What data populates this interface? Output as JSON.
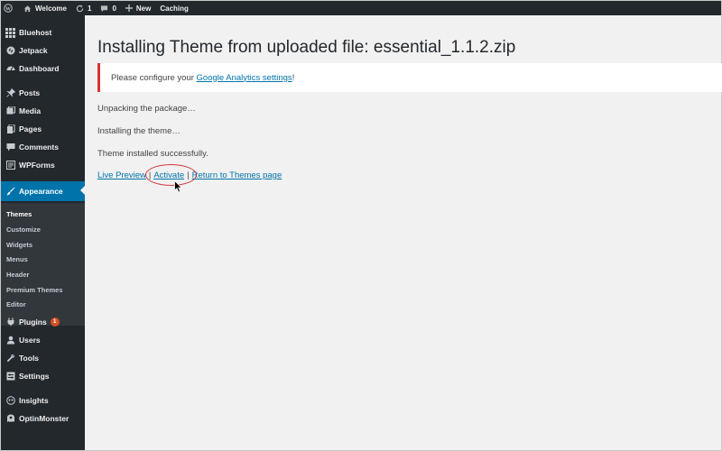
{
  "adminbar": {
    "site": "Welcome",
    "updates": "1",
    "comments": "0",
    "new_label": "New",
    "caching_label": "Caching"
  },
  "sidebar": {
    "items": [
      {
        "label": "Bluehost",
        "icon": "grid-icon"
      },
      {
        "label": "Jetpack",
        "icon": "jetpack-icon"
      },
      {
        "label": "Dashboard",
        "icon": "dashboard-icon"
      },
      {
        "label": "Posts",
        "icon": "pin-icon"
      },
      {
        "label": "Media",
        "icon": "media-icon"
      },
      {
        "label": "Pages",
        "icon": "pages-icon"
      },
      {
        "label": "Comments",
        "icon": "comment-icon"
      },
      {
        "label": "WPForms",
        "icon": "form-icon"
      },
      {
        "label": "Appearance",
        "icon": "brush-icon"
      },
      {
        "label": "Plugins",
        "icon": "plug-icon",
        "badge": "1"
      },
      {
        "label": "Users",
        "icon": "user-icon"
      },
      {
        "label": "Tools",
        "icon": "wrench-icon"
      },
      {
        "label": "Settings",
        "icon": "settings-icon"
      },
      {
        "label": "Insights",
        "icon": "insights-icon"
      },
      {
        "label": "OptinMonster",
        "icon": "monster-icon"
      }
    ],
    "submenu": [
      "Themes",
      "Customize",
      "Widgets",
      "Menus",
      "Header",
      "Premium Themes",
      "Editor"
    ],
    "active_item": "Appearance",
    "current_subitem": "Themes"
  },
  "main": {
    "title": "Installing Theme from uploaded file: essential_1.1.2.zip",
    "notice": {
      "prefix": "Please configure your ",
      "link": "Google Analytics settings",
      "suffix": "!"
    },
    "log": [
      "Unpacking the package…",
      "Installing the theme…",
      "Theme installed successfully."
    ],
    "actions": {
      "live_preview": "Live Preview",
      "activate": "Activate",
      "return": "Return to Themes page",
      "separator": "|"
    }
  },
  "colors": {
    "adminbar_bg": "#23282d",
    "sidebar_bg": "#23282d",
    "submenu_bg": "#32373c",
    "active_bg": "#0073aa",
    "link": "#0073aa",
    "notice_border": "#dc3232",
    "badge": "#d54e21",
    "annotation": "#d23939"
  }
}
